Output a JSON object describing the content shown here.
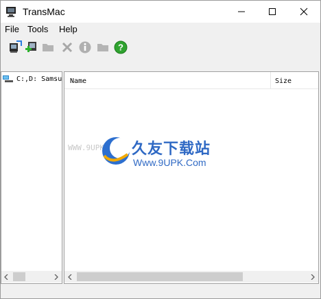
{
  "window": {
    "title": "TransMac"
  },
  "menu": [
    {
      "label": "File"
    },
    {
      "label": "Tools"
    },
    {
      "label": "Help"
    }
  ],
  "toolbar": {
    "buttons": [
      {
        "icon": "disk-image-icon",
        "enabled": true
      },
      {
        "icon": "add-file-icon",
        "enabled": true
      },
      {
        "icon": "folder-icon",
        "enabled": false
      },
      {
        "icon": "delete-x-icon",
        "enabled": false
      },
      {
        "icon": "info-icon",
        "enabled": false
      },
      {
        "icon": "folder-icon",
        "enabled": false
      },
      {
        "icon": "help-icon",
        "enabled": true
      }
    ]
  },
  "tree": {
    "items": [
      {
        "label": "C:,D: Samsu"
      }
    ]
  },
  "list": {
    "columns": [
      "Name",
      "Size"
    ]
  },
  "watermark": {
    "site_text": "WWW.9UPK.COM",
    "brand_cn": "久友下载站",
    "brand_url": "Www.9UPK.Com"
  }
}
